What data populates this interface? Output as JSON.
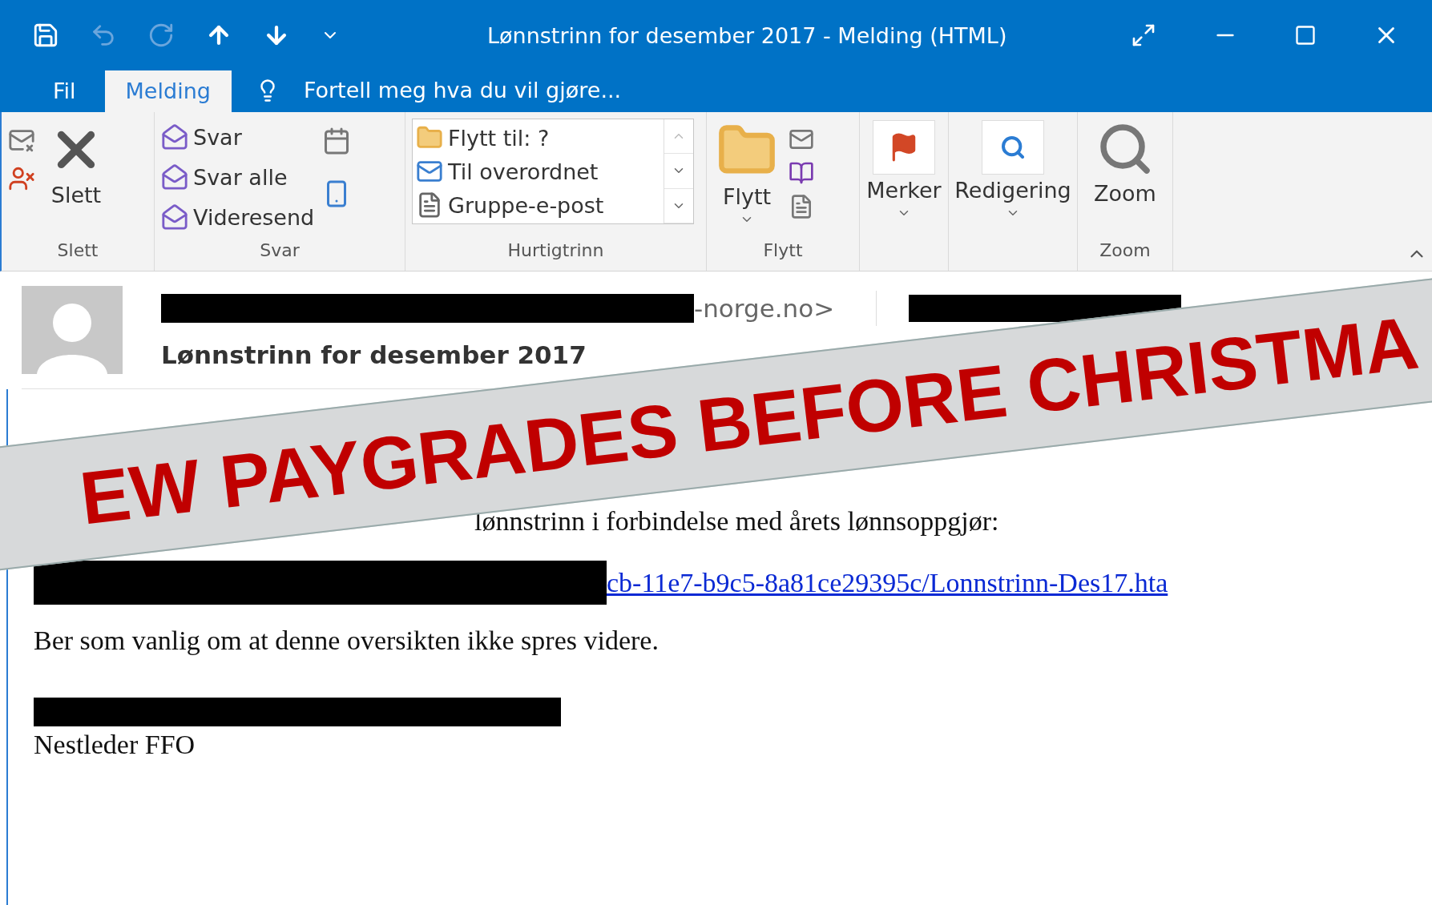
{
  "window": {
    "title": "Lønnstrinn for desember 2017 - Melding (HTML)"
  },
  "tabs": [
    {
      "label": "Fil",
      "selected": false
    },
    {
      "label": "Melding",
      "selected": true
    }
  ],
  "tell_me": "Fortell meg hva du vil gjøre...",
  "ribbon": {
    "delete_group": {
      "label": "Slett",
      "button": "Slett"
    },
    "respond_group": {
      "label": "Svar",
      "buttons": [
        "Svar",
        "Svar alle",
        "Videresend"
      ]
    },
    "quick_steps_group": {
      "label": "Hurtigtrinn",
      "items": [
        "Flytt til: ?",
        "Til overordnet",
        "Gruppe-e-post"
      ]
    },
    "move_group": {
      "label": "Flytt",
      "button": "Flytt"
    },
    "tags_group": {
      "button": "Merker"
    },
    "editing_group": {
      "button": "Redigering"
    },
    "zoom_group": {
      "label": "Zoom",
      "button": "Zoom"
    }
  },
  "header": {
    "sender_suffix": "-norge.no>",
    "subject": "Lønnstrinn for desember 2017"
  },
  "body": {
    "intro_visible": "lønnstrinn i forbindelse med årets lønnsoppgjør:",
    "link": "cb-11e7-b9c5-8a81ce29395c/Lonnstrinn-Des17.hta",
    "request": "Ber som vanlig om at denne oversikten ikke spres videre.",
    "signature_title": "Nestleder FFO"
  },
  "banner": {
    "words": [
      "EW",
      "PAYGRADES",
      "BEFORE",
      "CHRISTMA"
    ]
  }
}
